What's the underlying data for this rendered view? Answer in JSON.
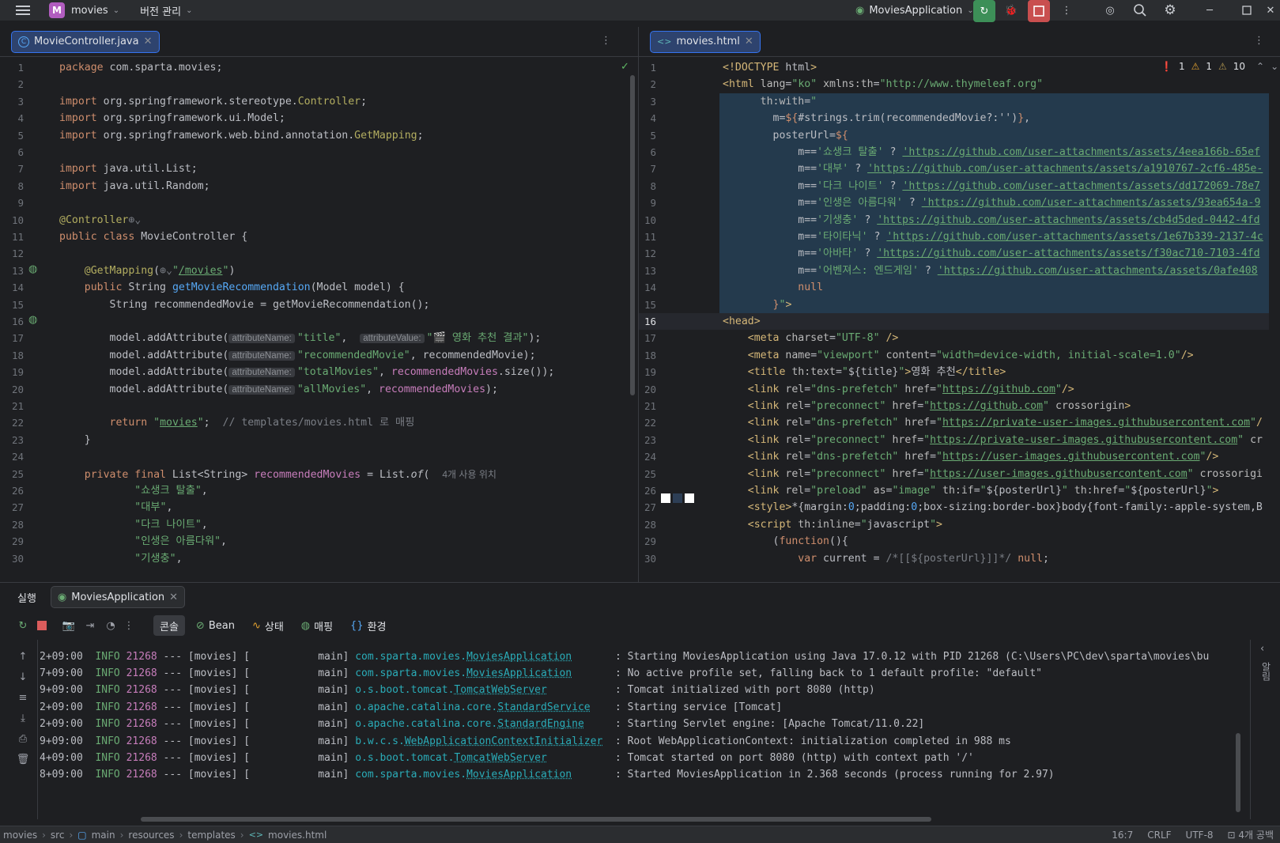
{
  "titlebar": {
    "project_badge": "M",
    "project": "movies",
    "vcs": "버전 관리",
    "run_config": "MoviesApplication"
  },
  "left_tab": {
    "title": "MovieController.java"
  },
  "right_tab": {
    "title": "movies.html",
    "errors": "1",
    "warnings": "1",
    "weak_warnings": "10"
  },
  "java_lines": [
    {
      "n": "1",
      "h": "<span class=\"kw\">package</span> com.sparta.movies;"
    },
    {
      "n": "2",
      "h": ""
    },
    {
      "n": "3",
      "h": "<span class=\"kw\">import</span> org.springframework.stereotype.<span class=\"ann\">Controller</span>;"
    },
    {
      "n": "4",
      "h": "<span class=\"kw\">import</span> org.springframework.ui.Model;"
    },
    {
      "n": "5",
      "h": "<span class=\"kw\">import</span> org.springframework.web.bind.annotation.<span class=\"ann\">GetMapping</span>;"
    },
    {
      "n": "6",
      "h": ""
    },
    {
      "n": "7",
      "h": "<span class=\"kw\">import</span> java.util.List;"
    },
    {
      "n": "8",
      "h": "<span class=\"kw\">import</span> java.util.Random;"
    },
    {
      "n": "9",
      "h": ""
    },
    {
      "n": "10",
      "h": "<span class=\"ann\">@Controller</span><span class=\"cm\">⊕⌄</span>"
    },
    {
      "n": "11",
      "h": "<span class=\"kw\">public class</span> MovieController {"
    },
    {
      "n": "12",
      "h": ""
    },
    {
      "n": "13",
      "h": "    <span class=\"ann\">@GetMapping</span>(<span class=\"cm\">⊕⌄</span><span class=\"str\">\"<u>/movies</u>\"</span>)"
    },
    {
      "n": "14",
      "h": "    <span class=\"kw\">public</span> String <span class=\"fn\">getMovieRecommendation</span>(Model model) {"
    },
    {
      "n": "15",
      "h": "        String recommendedMovie = getMovieRecommendation();"
    },
    {
      "n": "16",
      "h": ""
    },
    {
      "n": "17",
      "h": "        model.addAttribute(<span class=\"hint\">attributeName:</span><span class=\"str\">\"title\"</span>,  <span class=\"hint\">attributeValue:</span><span class=\"str\">\"🎬 영화 추천 결과\"</span>);"
    },
    {
      "n": "18",
      "h": "        model.addAttribute(<span class=\"hint\">attributeName:</span><span class=\"str\">\"recommendedMovie\"</span>, recommendedMovie);"
    },
    {
      "n": "19",
      "h": "        model.addAttribute(<span class=\"hint\">attributeName:</span><span class=\"str\">\"totalMovies\"</span>, <span class=\"fld\">recommendedMovies</span>.size());"
    },
    {
      "n": "20",
      "h": "        model.addAttribute(<span class=\"hint\">attributeName:</span><span class=\"str\">\"allMovies\"</span>, <span class=\"fld\">recommendedMovies</span>);"
    },
    {
      "n": "21",
      "h": ""
    },
    {
      "n": "22",
      "h": "        <span class=\"kw\">return</span> <span class=\"str\">\"<u>movies</u>\"</span>;  <span class=\"cm\">// templates/movies.html 로 매핑</span>"
    },
    {
      "n": "23",
      "h": "    }"
    },
    {
      "n": "24",
      "h": ""
    },
    {
      "n": "25",
      "h": "    <span class=\"kw\">private final</span> List&lt;String&gt; <span class=\"fld\">recommendedMovies</span> = List.<i>of</i>(  <span class=\"cm\" style=\"font-family:'Liberation Sans',sans-serif;font-size:12px\">4개 사용 위치</span>"
    },
    {
      "n": "26",
      "h": "            <span class=\"str\">\"쇼생크 탈출\"</span>,"
    },
    {
      "n": "27",
      "h": "            <span class=\"str\">\"대부\"</span>,"
    },
    {
      "n": "28",
      "h": "            <span class=\"str\">\"다크 나이트\"</span>,"
    },
    {
      "n": "29",
      "h": "            <span class=\"str\">\"인생은 아름다워\"</span>,"
    },
    {
      "n": "30",
      "h": "            <span class=\"str\">\"기생충\"</span>,"
    }
  ],
  "html_lines": [
    {
      "n": "1",
      "h": "<span class=\"tag\">&lt;!DOCTYPE</span> html<span class=\"tag\">&gt;</span>"
    },
    {
      "n": "2",
      "h": "<span class=\"tag\">&lt;html</span> <span class=\"attr\">lang</span>=<span class=\"attrv\">\"ko\"</span> <span class=\"attr\">xmlns:th</span>=<span class=\"attrv\">\"http://www.thymeleaf.org\"</span>"
    },
    {
      "n": "3",
      "h": "      <span class=\"attr\">th:with</span>=<span class=\"attrv\">\"</span>"
    },
    {
      "n": "4",
      "h": "        m=<span class=\"kw\">${</span>#strings.trim(recommendedMovie?:'')<span class=\"kw\">}</span>,"
    },
    {
      "n": "5",
      "h": "        posterUrl=<span class=\"kw\">${</span>"
    },
    {
      "n": "6",
      "h": "            m==<span class=\"str\">'쇼생크 탈출'</span> ? <span class=\"url\">'https://github.com/user-attachments/assets/4eea166b-65ef</span>"
    },
    {
      "n": "7",
      "h": "            m==<span class=\"str\">'대부'</span> ? <span class=\"url\">'https://github.com/user-attachments/assets/a1910767-2cf6-485e-</span>"
    },
    {
      "n": "8",
      "h": "            m==<span class=\"str\">'다크 나이트'</span> ? <span class=\"url\">'https://github.com/user-attachments/assets/dd172069-78e7</span>"
    },
    {
      "n": "9",
      "h": "            m==<span class=\"str\">'인생은 아름다워'</span> ? <span class=\"url\">'https://github.com/user-attachments/assets/93ea654a-9</span>"
    },
    {
      "n": "10",
      "h": "            m==<span class=\"str\">'기생충'</span> ? <span class=\"url\">'https://github.com/user-attachments/assets/cb4d5ded-0442-4fd</span>"
    },
    {
      "n": "11",
      "h": "            m==<span class=\"str\">'타이타닉'</span> ? <span class=\"url\">'https://github.com/user-attachments/assets/1e67b339-2137-4c</span>"
    },
    {
      "n": "12",
      "h": "            m==<span class=\"str\">'아바타'</span> ? <span class=\"url\">'https://github.com/user-attachments/assets/f30ac710-7103-4fd</span>"
    },
    {
      "n": "13",
      "h": "            m==<span class=\"str\">'어벤져스: 엔드게임'</span> ? <span class=\"url\">'https://github.com/user-attachments/assets/0afe408</span>"
    },
    {
      "n": "14",
      "h": "            <span class=\"kw\">null</span>"
    },
    {
      "n": "15",
      "h": "        <span class=\"kw\">}</span><span class=\"attrv\">\"</span><span class=\"tag\">&gt;</span>"
    },
    {
      "n": "16",
      "h": "<span class=\"tag\">&lt;head&gt;</span>"
    },
    {
      "n": "17",
      "h": "    <span class=\"tag\">&lt;meta</span> <span class=\"attr\">charset</span>=<span class=\"attrv\">\"UTF-8\"</span> <span class=\"tag\">/&gt;</span>"
    },
    {
      "n": "18",
      "h": "    <span class=\"tag\">&lt;meta</span> <span class=\"attr\">name</span>=<span class=\"attrv\">\"viewport\"</span> <span class=\"attr\">content</span>=<span class=\"attrv\">\"width=device-width, initial-scale=1.0\"</span><span class=\"tag\">/&gt;</span>"
    },
    {
      "n": "19",
      "h": "    <span class=\"tag\">&lt;title</span> <span class=\"attr\">th:text</span>=<span class=\"attrv\">\"</span>${title}<span class=\"attrv\">\"</span><span class=\"tag\">&gt;</span>영화 추천<span class=\"tag\">&lt;/title&gt;</span>"
    },
    {
      "n": "20",
      "h": "    <span class=\"tag\">&lt;link</span> <span class=\"attr\">rel</span>=<span class=\"attrv\">\"dns-prefetch\"</span> <span class=\"attr\">href</span>=<span class=\"attrv\">\"</span><span class=\"url\">https://github.com</span><span class=\"attrv\">\"</span><span class=\"tag\">/&gt;</span>"
    },
    {
      "n": "21",
      "h": "    <span class=\"tag\">&lt;link</span> <span class=\"attr\">rel</span>=<span class=\"attrv\">\"preconnect\"</span> <span class=\"attr\">href</span>=<span class=\"attrv\">\"</span><span class=\"url\">https://github.com</span><span class=\"attrv\">\"</span> <span class=\"attr\">crossorigin</span><span class=\"tag\">&gt;</span>"
    },
    {
      "n": "22",
      "h": "    <span class=\"tag\">&lt;link</span> <span class=\"attr\">rel</span>=<span class=\"attrv\">\"dns-prefetch\"</span> <span class=\"attr\">href</span>=<span class=\"attrv\">\"</span><span class=\"url\">https://private-user-images.githubusercontent.com</span><span class=\"attrv\">\"</span><span class=\"tag\">/</span>"
    },
    {
      "n": "23",
      "h": "    <span class=\"tag\">&lt;link</span> <span class=\"attr\">rel</span>=<span class=\"attrv\">\"preconnect\"</span> <span class=\"attr\">href</span>=<span class=\"attrv\">\"</span><span class=\"url\">https://private-user-images.githubusercontent.com</span><span class=\"attrv\">\"</span> <span class=\"attr\">cr</span>"
    },
    {
      "n": "24",
      "h": "    <span class=\"tag\">&lt;link</span> <span class=\"attr\">rel</span>=<span class=\"attrv\">\"dns-prefetch\"</span> <span class=\"attr\">href</span>=<span class=\"attrv\">\"</span><span class=\"url\">https://user-images.githubusercontent.com</span><span class=\"attrv\">\"</span><span class=\"tag\">/&gt;</span>"
    },
    {
      "n": "25",
      "h": "    <span class=\"tag\">&lt;link</span> <span class=\"attr\">rel</span>=<span class=\"attrv\">\"preconnect\"</span> <span class=\"attr\">href</span>=<span class=\"attrv\">\"</span><span class=\"url\">https://user-images.githubusercontent.com</span><span class=\"attrv\">\"</span> <span class=\"attr\">crossorigi</span>"
    },
    {
      "n": "26",
      "h": "    <span class=\"tag\">&lt;link</span> <span class=\"attr\">rel</span>=<span class=\"attrv\">\"preload\"</span> <span class=\"attr\">as</span>=<span class=\"attrv\">\"image\"</span> <span class=\"attr\">th:if</span>=<span class=\"attrv\">\"</span>${posterUrl}<span class=\"attrv\">\"</span> <span class=\"attr\">th:href</span>=<span class=\"attrv\">\"</span>${posterUrl}<span class=\"attrv\">\"</span><span class=\"tag\">&gt;</span>"
    },
    {
      "n": "27",
      "h": "    <span class=\"tag\">&lt;style&gt;</span>*{margin:<span class=\"fn\">0</span>;padding:<span class=\"fn\">0</span>;box-sizing:border-box}body{font-family:-apple-system,B"
    },
    {
      "n": "28",
      "h": "    <span class=\"tag\">&lt;script</span> <span class=\"attr\">th:inline</span>=<span class=\"attrv\">\"</span>javascript<span class=\"attrv\">\"</span><span class=\"tag\">&gt;</span>"
    },
    {
      "n": "29",
      "h": "        (<span class=\"kw\">function</span>(){"
    },
    {
      "n": "30",
      "h": "            <span class=\"kw\">var</span> current = <span class=\"cm\">/*[[${posterUrl}]]*/</span> <span class=\"kw\">null</span>;"
    }
  ],
  "run": {
    "label": "실행",
    "tab": "MoviesApplication",
    "tools": {
      "console": "콘솔",
      "bean": "Bean",
      "status": "상태",
      "mapping": "매핑",
      "env": "환경"
    },
    "side_label": "알림"
  },
  "logs": [
    {
      "t": "2+09:00",
      "lvl": "INFO",
      "pid": "21268",
      "thread": "main",
      "pkg": "com.sparta.movies.",
      "cls": "MoviesApplication",
      "pad": "      ",
      "msg": ": Starting MoviesApplication using Java 17.0.12 with PID 21268 (C:\\Users\\PC\\dev\\sparta\\movies\\bu"
    },
    {
      "t": "7+09:00",
      "lvl": "INFO",
      "pid": "21268",
      "thread": "main",
      "pkg": "com.sparta.movies.",
      "cls": "MoviesApplication",
      "pad": "      ",
      "msg": ": No active profile set, falling back to 1 default profile: \"default\""
    },
    {
      "t": "9+09:00",
      "lvl": "INFO",
      "pid": "21268",
      "thread": "main",
      "pkg": "o.s.boot.tomcat.",
      "cls": "TomcatWebServer",
      "pad": "          ",
      "msg": ": Tomcat initialized with port 8080 (http)"
    },
    {
      "t": "2+09:00",
      "lvl": "INFO",
      "pid": "21268",
      "thread": "main",
      "pkg": "o.apache.catalina.core.",
      "cls": "StandardService",
      "pad": "   ",
      "msg": ": Starting service [Tomcat]"
    },
    {
      "t": "2+09:00",
      "lvl": "INFO",
      "pid": "21268",
      "thread": "main",
      "pkg": "o.apache.catalina.core.",
      "cls": "StandardEngine",
      "pad": "    ",
      "msg": ": Starting Servlet engine: [Apache Tomcat/11.0.22]"
    },
    {
      "t": "9+09:00",
      "lvl": "INFO",
      "pid": "21268",
      "thread": "main",
      "pkg": "b.w.c.s.",
      "cls": "WebApplicationContextInitializer",
      "pad": " ",
      "msg": ": Root WebApplicationContext: initialization completed in 988 ms"
    },
    {
      "t": "4+09:00",
      "lvl": "INFO",
      "pid": "21268",
      "thread": "main",
      "pkg": "o.s.boot.tomcat.",
      "cls": "TomcatWebServer",
      "pad": "          ",
      "msg": ": Tomcat started on port 8080 (http) with context path '/'"
    },
    {
      "t": "8+09:00",
      "lvl": "INFO",
      "pid": "21268",
      "thread": "main",
      "pkg": "com.sparta.movies.",
      "cls": "MoviesApplication",
      "pad": "      ",
      "msg": ": Started MoviesApplication in 2.368 seconds (process running for 2.97)"
    }
  ],
  "status": {
    "crumbs": [
      "movies",
      "src",
      "main",
      "resources",
      "templates",
      "movies.html"
    ],
    "position": "16:7",
    "line_sep": "CRLF",
    "encoding": "UTF-8",
    "indent": "4개 공백"
  }
}
